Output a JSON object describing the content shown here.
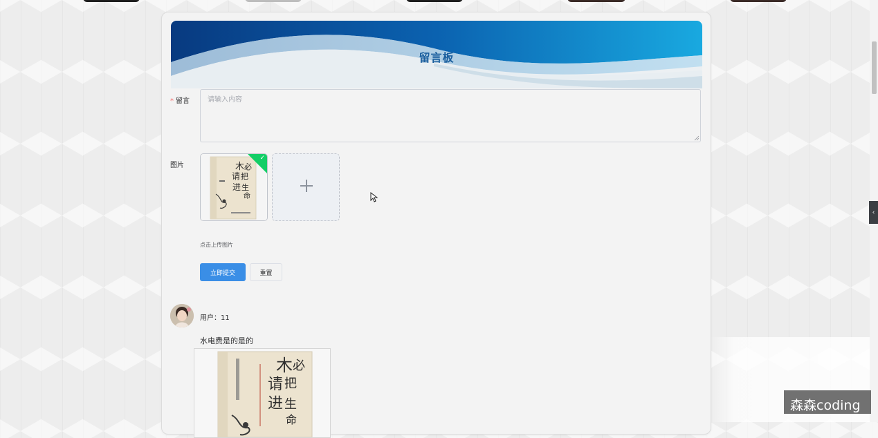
{
  "board": {
    "title": "留言板"
  },
  "form": {
    "message_label": "留言",
    "required_mark": "*",
    "message_placeholder": "请输入内容",
    "image_label": "图片",
    "upload_tip": "点击上传图片",
    "submit_label": "立即提交",
    "reset_label": "重置"
  },
  "uploaded_image": {
    "status": "success"
  },
  "messages": [
    {
      "user_line": "用户：11",
      "content": "水电费是的是的"
    }
  ],
  "side_tab": {
    "glyph": "‹"
  },
  "watermark": {
    "text": "森森coding"
  },
  "colors": {
    "primary": "#3a8ee6",
    "banner_dark": "#0b3f86",
    "banner_light": "#19a9e0",
    "title": "#1b5f9e",
    "success": "#13ce66",
    "required": "#f56c6c"
  },
  "icons": [
    "plus-icon",
    "check-icon",
    "chevron-left-icon",
    "cursor-icon"
  ]
}
